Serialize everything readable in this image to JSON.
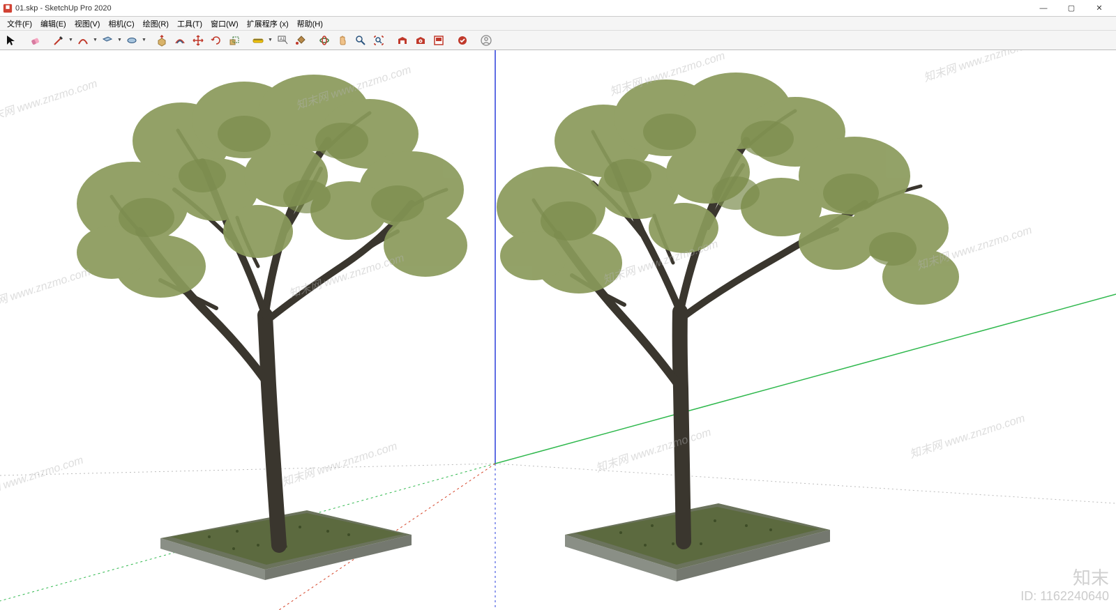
{
  "window": {
    "title": "01.skp - SketchUp Pro 2020",
    "controls": {
      "minimize": "—",
      "maximize": "▢",
      "close": "✕"
    }
  },
  "menu": {
    "items": [
      {
        "label": "文件(F)"
      },
      {
        "label": "编辑(E)"
      },
      {
        "label": "视图(V)"
      },
      {
        "label": "相机(C)"
      },
      {
        "label": "绘图(R)"
      },
      {
        "label": "工具(T)"
      },
      {
        "label": "窗口(W)"
      },
      {
        "label": "扩展程序 (x)"
      },
      {
        "label": "帮助(H)"
      }
    ]
  },
  "toolbar": {
    "items": [
      {
        "name": "select-tool"
      },
      {
        "name": "eraser-tool"
      },
      {
        "name": "line-tool",
        "dropdown": true
      },
      {
        "name": "arc-tool",
        "dropdown": true
      },
      {
        "name": "rectangle-tool",
        "dropdown": true
      },
      {
        "name": "circle-tool",
        "dropdown": true
      },
      {
        "name": "pushpull-tool"
      },
      {
        "name": "offset-tool"
      },
      {
        "name": "move-tool"
      },
      {
        "name": "rotate-tool"
      },
      {
        "name": "scale-tool"
      },
      {
        "name": "tape-measure-tool",
        "dropdown": true
      },
      {
        "name": "text-tool"
      },
      {
        "name": "paint-bucket-tool"
      },
      {
        "name": "orbit-tool"
      },
      {
        "name": "pan-tool"
      },
      {
        "name": "zoom-tool"
      },
      {
        "name": "zoom-extents-tool"
      },
      {
        "name": "3d-warehouse-tool"
      },
      {
        "name": "extension-warehouse-tool"
      },
      {
        "name": "layout-tool"
      },
      {
        "name": "extension-manager-tool"
      },
      {
        "name": "user-sign-in"
      }
    ]
  },
  "viewport": {
    "axes": {
      "blue": "#2a3fdc",
      "green": "#2fb84d",
      "red": "#d5452a"
    },
    "models": [
      {
        "type": "tree-in-planter",
        "position": "left"
      },
      {
        "type": "tree-in-planter",
        "position": "right"
      }
    ]
  },
  "watermark": {
    "text": "知末网 www.znzmo.com",
    "id_cn": "知末",
    "id_text": "ID: 1162240640"
  }
}
